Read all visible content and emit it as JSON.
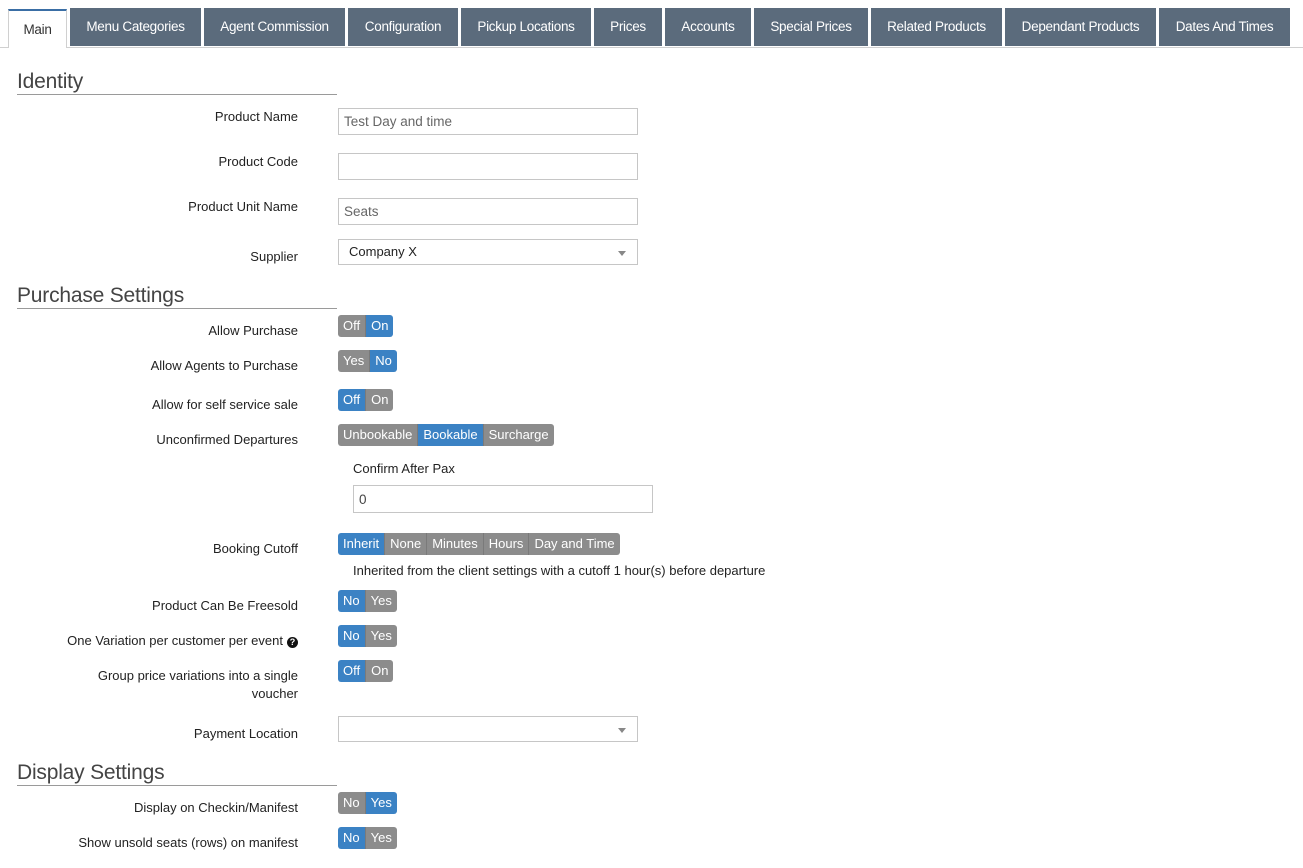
{
  "tabs": [
    {
      "label": "Main",
      "active": true
    },
    {
      "label": "Menu Categories"
    },
    {
      "label": "Agent Commission"
    },
    {
      "label": "Configuration"
    },
    {
      "label": "Pickup Locations"
    },
    {
      "label": "Prices"
    },
    {
      "label": "Accounts"
    },
    {
      "label": "Special Prices"
    },
    {
      "label": "Related Products"
    },
    {
      "label": "Dependant Products"
    },
    {
      "label": "Dates And Times"
    }
  ],
  "identity": {
    "title": "Identity",
    "product_name": {
      "label": "Product Name",
      "value": "Test Day and time"
    },
    "product_code": {
      "label": "Product Code",
      "value": ""
    },
    "product_unit_name": {
      "label": "Product Unit Name",
      "value": "Seats"
    },
    "supplier": {
      "label": "Supplier",
      "value": "Company X"
    }
  },
  "purchase": {
    "title": "Purchase Settings",
    "allow_purchase": {
      "label": "Allow Purchase",
      "options": [
        "Off",
        "On"
      ],
      "selected": "On"
    },
    "allow_agents": {
      "label": "Allow Agents to Purchase",
      "options": [
        "Yes",
        "No"
      ],
      "selected": "No"
    },
    "self_service": {
      "label": "Allow for self service sale",
      "options": [
        "Off",
        "On"
      ],
      "selected": "Off"
    },
    "unconfirmed": {
      "label": "Unconfirmed Departures",
      "options": [
        "Unbookable",
        "Bookable",
        "Surcharge"
      ],
      "selected": "Bookable"
    },
    "confirm_after_pax": {
      "label": "Confirm After Pax",
      "value": "0"
    },
    "booking_cutoff": {
      "label": "Booking Cutoff",
      "options": [
        "Inherit",
        "None",
        "Minutes",
        "Hours",
        "Day and Time"
      ],
      "selected": "Inherit",
      "help": "Inherited from the client settings with a cutoff 1 hour(s) before departure"
    },
    "freesold": {
      "label": "Product Can Be Freesold",
      "options": [
        "No",
        "Yes"
      ],
      "selected": "No"
    },
    "one_variation": {
      "label": "One Variation per customer per event",
      "options": [
        "No",
        "Yes"
      ],
      "selected": "No"
    },
    "group_price": {
      "label": "Group price variations into a single voucher",
      "options": [
        "Off",
        "On"
      ],
      "selected": "Off"
    },
    "payment_location": {
      "label": "Payment Location",
      "value": ""
    }
  },
  "display": {
    "title": "Display Settings",
    "checkin": {
      "label": "Display on Checkin/Manifest",
      "options": [
        "No",
        "Yes"
      ],
      "selected": "Yes"
    },
    "unsold_seats": {
      "label": "Show unsold seats (rows) on manifest",
      "options": [
        "No",
        "Yes"
      ],
      "selected": "No"
    }
  },
  "colors": {
    "tab_bg": "#5b6b7c",
    "accent": "#3b82c4",
    "inactive": "#8c8c8c"
  }
}
